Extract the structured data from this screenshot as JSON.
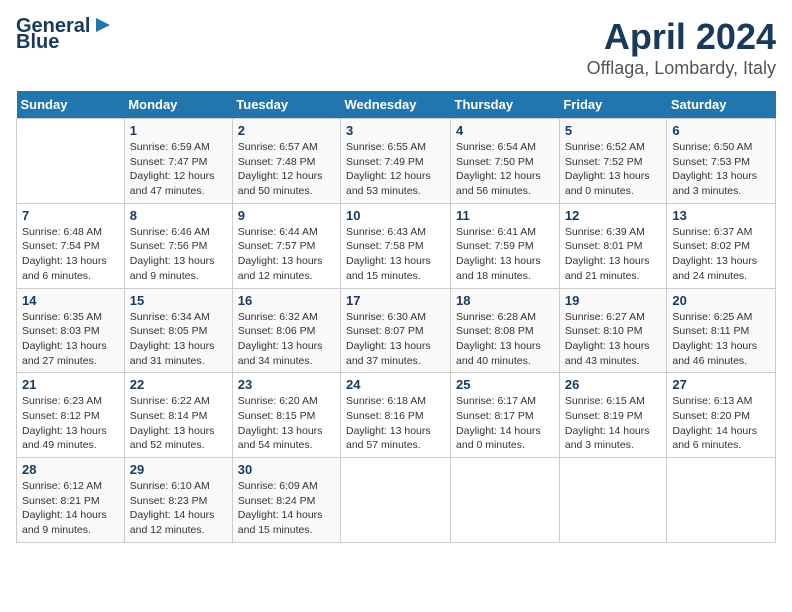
{
  "logo": {
    "line1": "General",
    "line2": "Blue"
  },
  "title": "April 2024",
  "subtitle": "Offlaga, Lombardy, Italy",
  "days_header": [
    "Sunday",
    "Monday",
    "Tuesday",
    "Wednesday",
    "Thursday",
    "Friday",
    "Saturday"
  ],
  "weeks": [
    [
      {
        "num": "",
        "info": ""
      },
      {
        "num": "1",
        "info": "Sunrise: 6:59 AM\nSunset: 7:47 PM\nDaylight: 12 hours\nand 47 minutes."
      },
      {
        "num": "2",
        "info": "Sunrise: 6:57 AM\nSunset: 7:48 PM\nDaylight: 12 hours\nand 50 minutes."
      },
      {
        "num": "3",
        "info": "Sunrise: 6:55 AM\nSunset: 7:49 PM\nDaylight: 12 hours\nand 53 minutes."
      },
      {
        "num": "4",
        "info": "Sunrise: 6:54 AM\nSunset: 7:50 PM\nDaylight: 12 hours\nand 56 minutes."
      },
      {
        "num": "5",
        "info": "Sunrise: 6:52 AM\nSunset: 7:52 PM\nDaylight: 13 hours\nand 0 minutes."
      },
      {
        "num": "6",
        "info": "Sunrise: 6:50 AM\nSunset: 7:53 PM\nDaylight: 13 hours\nand 3 minutes."
      }
    ],
    [
      {
        "num": "7",
        "info": "Sunrise: 6:48 AM\nSunset: 7:54 PM\nDaylight: 13 hours\nand 6 minutes."
      },
      {
        "num": "8",
        "info": "Sunrise: 6:46 AM\nSunset: 7:56 PM\nDaylight: 13 hours\nand 9 minutes."
      },
      {
        "num": "9",
        "info": "Sunrise: 6:44 AM\nSunset: 7:57 PM\nDaylight: 13 hours\nand 12 minutes."
      },
      {
        "num": "10",
        "info": "Sunrise: 6:43 AM\nSunset: 7:58 PM\nDaylight: 13 hours\nand 15 minutes."
      },
      {
        "num": "11",
        "info": "Sunrise: 6:41 AM\nSunset: 7:59 PM\nDaylight: 13 hours\nand 18 minutes."
      },
      {
        "num": "12",
        "info": "Sunrise: 6:39 AM\nSunset: 8:01 PM\nDaylight: 13 hours\nand 21 minutes."
      },
      {
        "num": "13",
        "info": "Sunrise: 6:37 AM\nSunset: 8:02 PM\nDaylight: 13 hours\nand 24 minutes."
      }
    ],
    [
      {
        "num": "14",
        "info": "Sunrise: 6:35 AM\nSunset: 8:03 PM\nDaylight: 13 hours\nand 27 minutes."
      },
      {
        "num": "15",
        "info": "Sunrise: 6:34 AM\nSunset: 8:05 PM\nDaylight: 13 hours\nand 31 minutes."
      },
      {
        "num": "16",
        "info": "Sunrise: 6:32 AM\nSunset: 8:06 PM\nDaylight: 13 hours\nand 34 minutes."
      },
      {
        "num": "17",
        "info": "Sunrise: 6:30 AM\nSunset: 8:07 PM\nDaylight: 13 hours\nand 37 minutes."
      },
      {
        "num": "18",
        "info": "Sunrise: 6:28 AM\nSunset: 8:08 PM\nDaylight: 13 hours\nand 40 minutes."
      },
      {
        "num": "19",
        "info": "Sunrise: 6:27 AM\nSunset: 8:10 PM\nDaylight: 13 hours\nand 43 minutes."
      },
      {
        "num": "20",
        "info": "Sunrise: 6:25 AM\nSunset: 8:11 PM\nDaylight: 13 hours\nand 46 minutes."
      }
    ],
    [
      {
        "num": "21",
        "info": "Sunrise: 6:23 AM\nSunset: 8:12 PM\nDaylight: 13 hours\nand 49 minutes."
      },
      {
        "num": "22",
        "info": "Sunrise: 6:22 AM\nSunset: 8:14 PM\nDaylight: 13 hours\nand 52 minutes."
      },
      {
        "num": "23",
        "info": "Sunrise: 6:20 AM\nSunset: 8:15 PM\nDaylight: 13 hours\nand 54 minutes."
      },
      {
        "num": "24",
        "info": "Sunrise: 6:18 AM\nSunset: 8:16 PM\nDaylight: 13 hours\nand 57 minutes."
      },
      {
        "num": "25",
        "info": "Sunrise: 6:17 AM\nSunset: 8:17 PM\nDaylight: 14 hours\nand 0 minutes."
      },
      {
        "num": "26",
        "info": "Sunrise: 6:15 AM\nSunset: 8:19 PM\nDaylight: 14 hours\nand 3 minutes."
      },
      {
        "num": "27",
        "info": "Sunrise: 6:13 AM\nSunset: 8:20 PM\nDaylight: 14 hours\nand 6 minutes."
      }
    ],
    [
      {
        "num": "28",
        "info": "Sunrise: 6:12 AM\nSunset: 8:21 PM\nDaylight: 14 hours\nand 9 minutes."
      },
      {
        "num": "29",
        "info": "Sunrise: 6:10 AM\nSunset: 8:23 PM\nDaylight: 14 hours\nand 12 minutes."
      },
      {
        "num": "30",
        "info": "Sunrise: 6:09 AM\nSunset: 8:24 PM\nDaylight: 14 hours\nand 15 minutes."
      },
      {
        "num": "",
        "info": ""
      },
      {
        "num": "",
        "info": ""
      },
      {
        "num": "",
        "info": ""
      },
      {
        "num": "",
        "info": ""
      }
    ]
  ]
}
